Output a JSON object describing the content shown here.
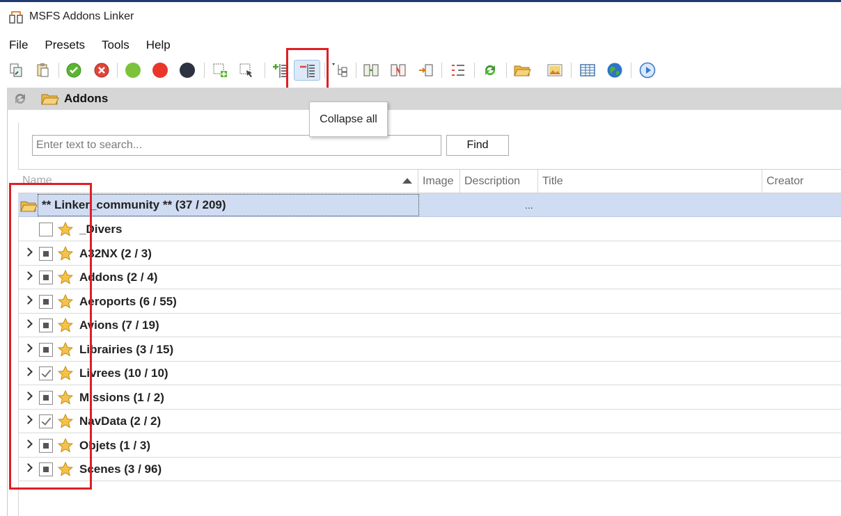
{
  "window": {
    "title": "MSFS Addons Linker"
  },
  "menu": [
    "File",
    "Presets",
    "Tools",
    "Help"
  ],
  "toolbar": {
    "buttons": [
      {
        "icon": "copy-icon"
      },
      {
        "icon": "paste-icon"
      },
      {
        "icon": "green-check-icon"
      },
      {
        "icon": "red-x-icon"
      },
      {
        "icon": "green-dot-icon"
      },
      {
        "icon": "red-dot-icon"
      },
      {
        "icon": "dark-dot-icon"
      },
      {
        "icon": "select-add-icon"
      },
      {
        "icon": "select-remove-icon"
      },
      {
        "icon": "expand-all-icon"
      },
      {
        "icon": "collapse-all-icon",
        "selected": true
      },
      {
        "icon": "tree-options-icon"
      },
      {
        "icon": "link-icon"
      },
      {
        "icon": "unlink-icon"
      },
      {
        "icon": "relink-icon"
      },
      {
        "icon": "list-checked-icon"
      },
      {
        "icon": "refresh-icon"
      },
      {
        "icon": "open-folder-icon"
      },
      {
        "icon": "image-icon"
      },
      {
        "icon": "table-icon"
      },
      {
        "icon": "globe-icon"
      },
      {
        "icon": "play-icon"
      }
    ],
    "tooltip": "Collapse all"
  },
  "panel": {
    "title": "Addons"
  },
  "search": {
    "placeholder": "Enter text to search...",
    "value": "",
    "find_label": "Find"
  },
  "columns": [
    "Name",
    "Image",
    "Description",
    "Title",
    "Creator"
  ],
  "root": {
    "label": "** Linker_community ** (37 / 209)",
    "description": "..."
  },
  "rows": [
    {
      "label": "_Divers",
      "state": "unchecked",
      "expandable": false
    },
    {
      "label": "A32NX (2 / 3)",
      "state": "partial",
      "expandable": true
    },
    {
      "label": "Addons (2 / 4)",
      "state": "partial",
      "expandable": true
    },
    {
      "label": "Aeroports (6 / 55)",
      "state": "partial",
      "expandable": true
    },
    {
      "label": "Avions (7 / 19)",
      "state": "partial",
      "expandable": true
    },
    {
      "label": "Librairies (3 / 15)",
      "state": "partial",
      "expandable": true
    },
    {
      "label": "Livrees (10 / 10)",
      "state": "checked",
      "expandable": true
    },
    {
      "label": "Missions (1 / 2)",
      "state": "partial",
      "expandable": true
    },
    {
      "label": "NavData (2 / 2)",
      "state": "checked",
      "expandable": true
    },
    {
      "label": "Objets (1 / 3)",
      "state": "partial",
      "expandable": true
    },
    {
      "label": "Scenes (3 / 96)",
      "state": "partial",
      "expandable": true
    }
  ],
  "colors": {
    "highlight": "#e01e24",
    "selected_row": "#cfdcf2",
    "header_band": "#d6d6d6"
  }
}
